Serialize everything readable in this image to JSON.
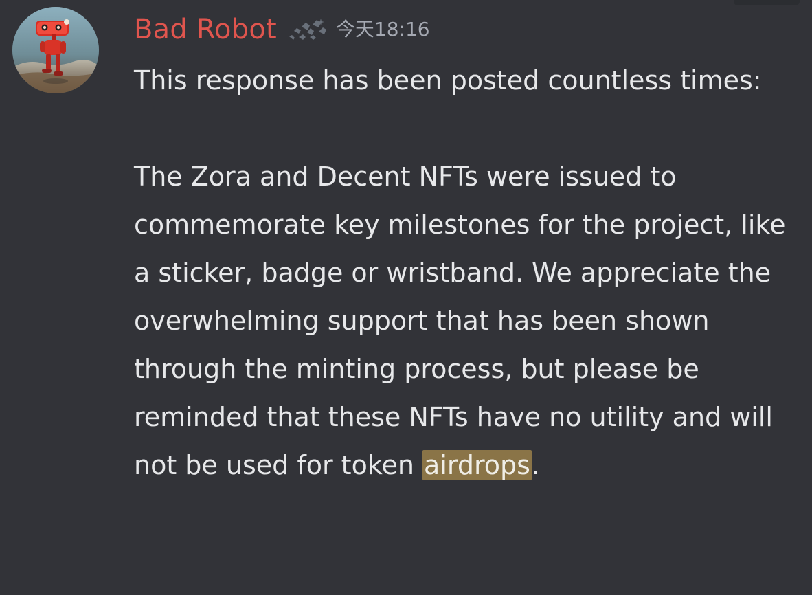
{
  "message": {
    "author": "Bad Robot",
    "timestamp": "今天18:16",
    "body_part_1": "This response has been posted countless times:\n\nThe Zora and Decent NFTs were issued to commemorate key milestones for the project, like a sticker, badge or wristband. We appreciate the overwhelming support that has been shown through the minting process, but please be reminded that these NFTs have no utility and will not be used for token ",
    "highlighted_word": "airdrops",
    "body_part_3": "."
  },
  "icons": {
    "avatar": "robot-avatar",
    "badge": "sparkle-badge-icon"
  },
  "colors": {
    "background": "#323338",
    "author": "#e0554e",
    "timestamp": "#a5a9b2",
    "text": "#e7e8ea",
    "highlight": "#8a7447"
  }
}
